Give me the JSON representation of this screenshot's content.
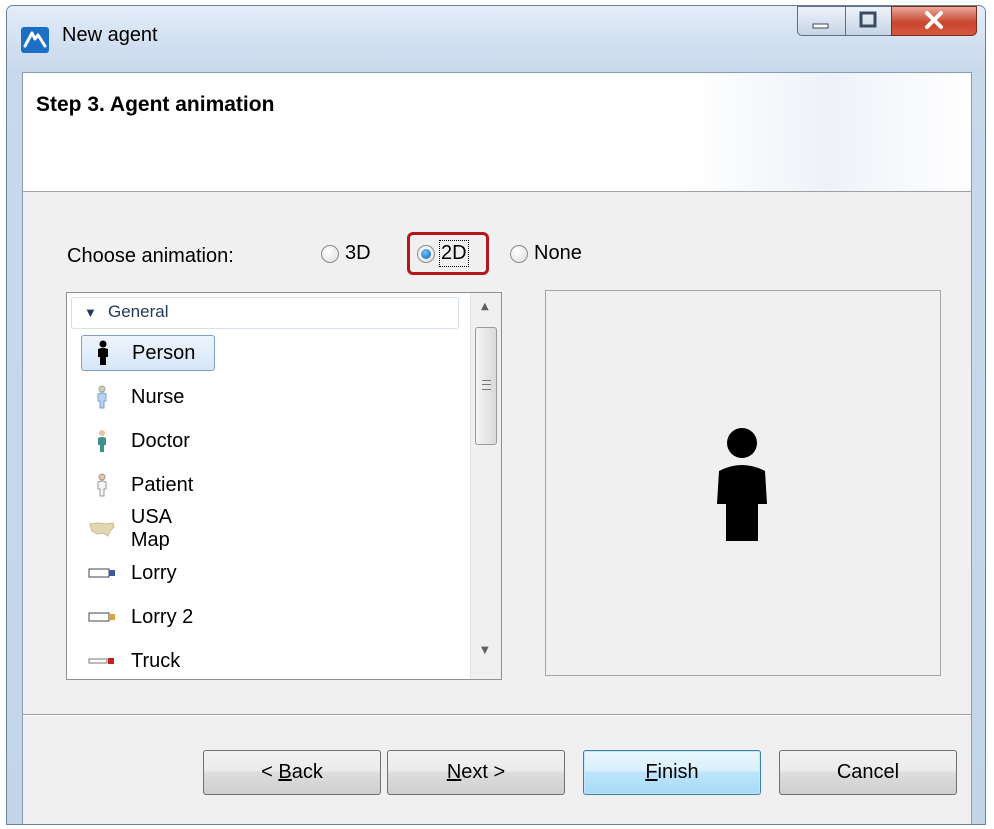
{
  "window": {
    "title": "New agent"
  },
  "header": {
    "step_title": "Step 3. Agent animation"
  },
  "animation": {
    "label": "Choose animation:",
    "options": [
      {
        "label": "3D",
        "checked": false
      },
      {
        "label": "2D",
        "checked": true
      },
      {
        "label": "None",
        "checked": false
      }
    ]
  },
  "list": {
    "group": "General",
    "items": [
      {
        "label": "Person",
        "icon": "person-icon",
        "selected": true
      },
      {
        "label": "Nurse",
        "icon": "nurse-icon",
        "selected": false
      },
      {
        "label": "Doctor",
        "icon": "doctor-icon",
        "selected": false
      },
      {
        "label": "Patient",
        "icon": "patient-icon",
        "selected": false
      },
      {
        "label": "USA Map",
        "icon": "usa-map-icon",
        "selected": false
      },
      {
        "label": "Lorry",
        "icon": "lorry-icon",
        "selected": false
      },
      {
        "label": "Lorry 2",
        "icon": "lorry-2-icon",
        "selected": false
      },
      {
        "label": "Truck",
        "icon": "truck-icon",
        "selected": false
      }
    ]
  },
  "buttons": {
    "back_prefix": "< ",
    "back_mnemonic": "B",
    "back_rest": "ack",
    "next_mnemonic": "N",
    "next_rest": "ext >",
    "finish_mnemonic": "F",
    "finish_rest": "inish",
    "cancel": "Cancel"
  },
  "colors": {
    "highlight": "#b3161c",
    "accent": "#0b5fb3"
  }
}
